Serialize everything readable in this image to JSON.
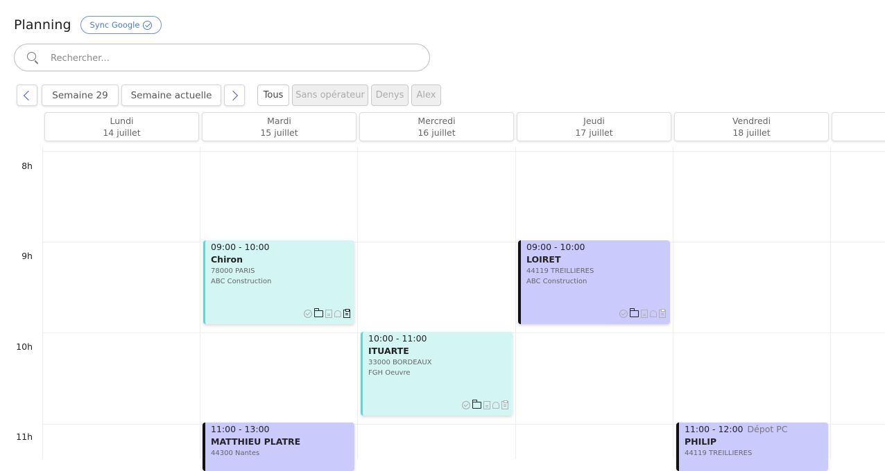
{
  "header": {
    "title": "Planning",
    "sync_label": "Sync Google"
  },
  "search": {
    "placeholder": "Rechercher...",
    "value": ""
  },
  "nav": {
    "week_label": "Semaine 29",
    "current_week_label": "Semaine actuelle"
  },
  "filters": [
    {
      "label": "Tous",
      "active": true
    },
    {
      "label": "Sans opérateur",
      "active": false
    },
    {
      "label": "Denys",
      "active": false
    },
    {
      "label": "Alex",
      "active": false
    }
  ],
  "days": [
    {
      "name": "Lundi",
      "date": "14 juillet"
    },
    {
      "name": "Mardi",
      "date": "15 juillet"
    },
    {
      "name": "Mercredi",
      "date": "16 juillet"
    },
    {
      "name": "Jeudi",
      "date": "17 juillet"
    },
    {
      "name": "Vendredi",
      "date": "18 juillet"
    }
  ],
  "hours": [
    "8h",
    "9h",
    "10h",
    "11h"
  ],
  "events": [
    {
      "time": "09:00 - 10:00",
      "client": "Chiron",
      "address": "78000 PARIS",
      "company": "ABC Construction",
      "color": "#d3f5f4"
    },
    {
      "time": "09:00 - 10:00",
      "client": "LOIRET",
      "address": "44119 TREILLIERES",
      "company": "ABC Construction",
      "color": "#cbcafd"
    },
    {
      "time": "10:00 - 11:00",
      "client": "ITUARTE",
      "address": "33000 BORDEAUX",
      "company": "FGH Oeuvre",
      "color": "#d3f5f4"
    },
    {
      "time": "11:00 - 13:00",
      "client": "MATTHIEU PLATRE",
      "address": "44300 Nantes",
      "company": "",
      "color": "#cbcafd"
    },
    {
      "time": "11:00 - 12:00",
      "tag": "Dépot PC",
      "client": "PHILIP",
      "address": "44119 TREILLIERES",
      "company": "",
      "color": "#cbcafd"
    }
  ],
  "colors": {
    "accent": "#3b5bd6",
    "sync": "#4a7ad6",
    "teal_event": "#d3f5f4",
    "purple_event": "#cbcafd",
    "teal_border": "#5fd6cf"
  }
}
